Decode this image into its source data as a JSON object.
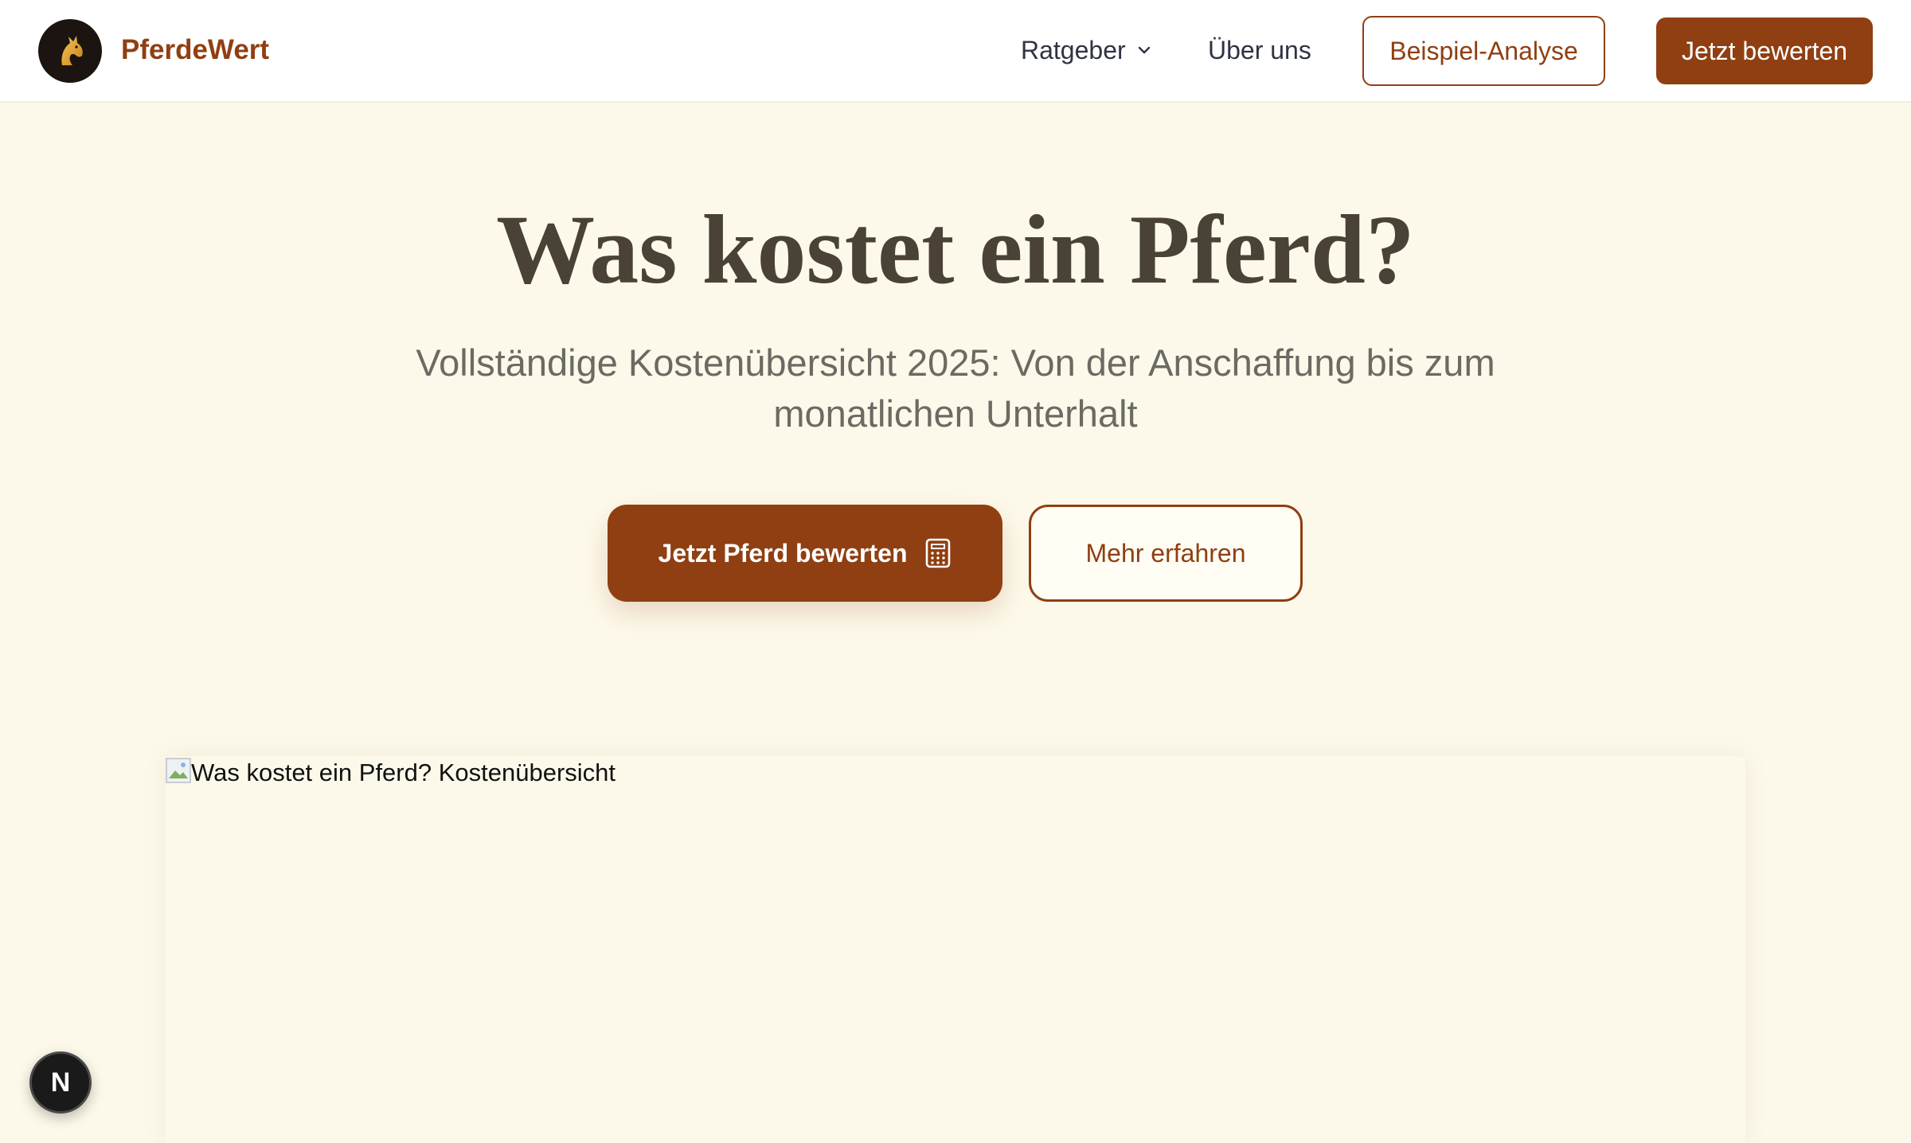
{
  "header": {
    "brand": "PferdeWert",
    "nav": {
      "ratgeber": "Ratgeber",
      "ueber_uns": "Über uns"
    },
    "buttons": {
      "beispiel": "Beispiel-Analyse",
      "jetzt": "Jetzt bewerten"
    }
  },
  "hero": {
    "title": "Was kostet ein Pferd?",
    "subtitle": "Vollständige Kostenübersicht 2025: Von der Anschaffung bis zum monatlichen Unterhalt",
    "cta_primary": "Jetzt Pferd bewerten",
    "cta_secondary": "Mehr erfahren"
  },
  "image": {
    "alt": "Was kostet ein Pferd? Kostenübersicht"
  },
  "dev_badge": {
    "label": "N"
  },
  "icons": {
    "logo": "horse-head-icon",
    "dropdown": "chevron-down-icon",
    "cta": "calculator-icon",
    "broken_image": "broken-image-icon"
  },
  "colors": {
    "brand": "#8f3f12",
    "background": "#fdf9ea",
    "title": "#4a4236",
    "subtitle": "#6b6a63"
  }
}
